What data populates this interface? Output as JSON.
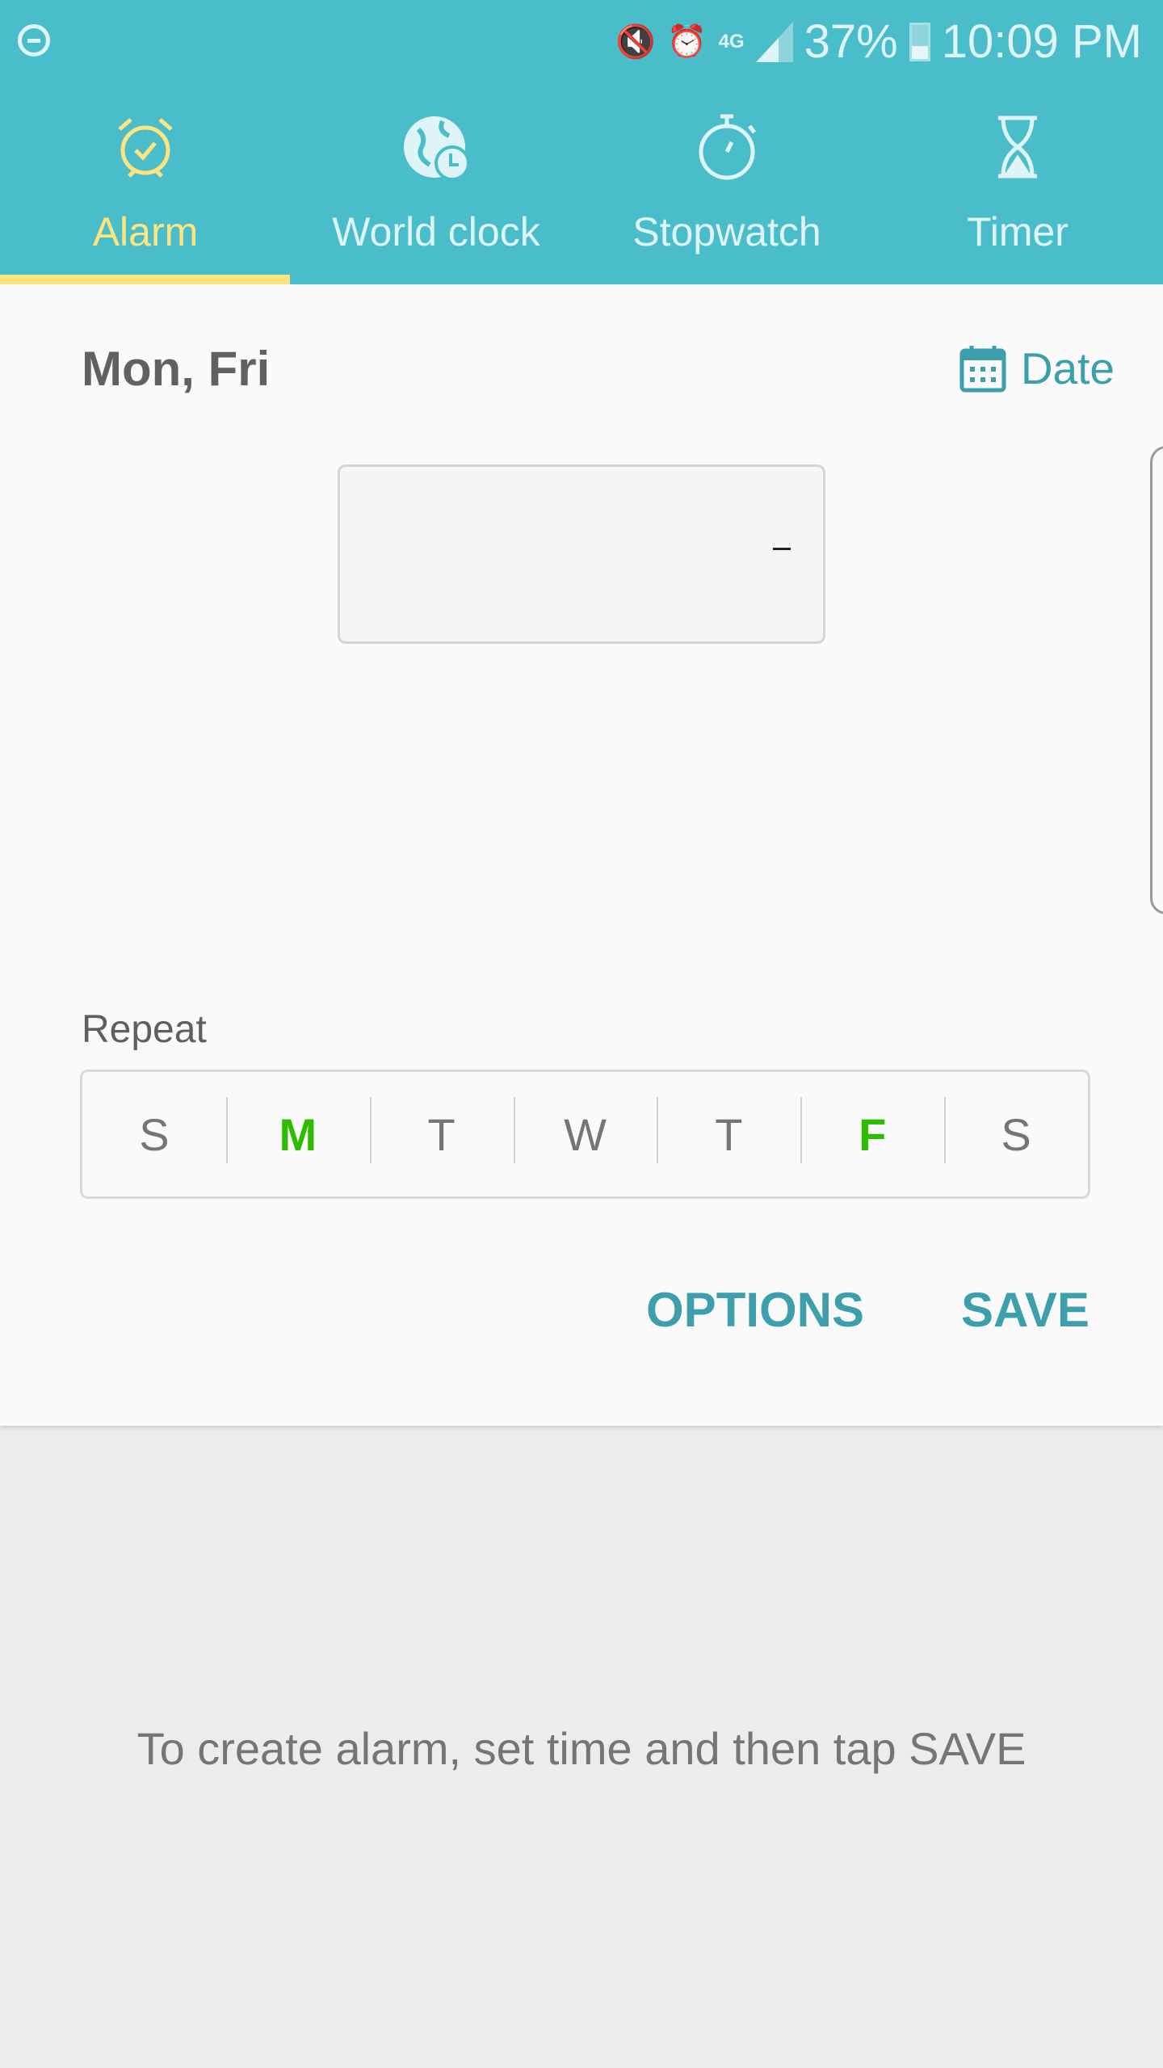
{
  "status_bar": {
    "battery": "37%",
    "time": "10:09 PM",
    "network": "4G",
    "icons": [
      "do-not-disturb-icon",
      "vibrate-mute-icon",
      "alarm-icon",
      "network-4g-icon",
      "signal-icon",
      "battery-icon"
    ]
  },
  "tabs": [
    {
      "label": "Alarm",
      "icon": "alarm-clock-icon",
      "active": true
    },
    {
      "label": "World clock",
      "icon": "globe-clock-icon"
    },
    {
      "label": "Stopwatch",
      "icon": "stopwatch-icon"
    },
    {
      "label": "Timer",
      "icon": "hourglass-icon"
    }
  ],
  "editor": {
    "days_summary": "Mon, Fri",
    "date_label": "Date",
    "repeat_label": "Repeat",
    "days": [
      {
        "label": "S",
        "on": false
      },
      {
        "label": "M",
        "on": true
      },
      {
        "label": "T",
        "on": false
      },
      {
        "label": "W",
        "on": false
      },
      {
        "label": "T",
        "on": false
      },
      {
        "label": "F",
        "on": true
      },
      {
        "label": "S",
        "on": false
      }
    ],
    "options_label": "OPTIONS",
    "save_label": "SAVE"
  },
  "hint": "To create alarm, set time and then tap SAVE",
  "colors": {
    "header": "#4abdcb",
    "active_tab": "#fde47f",
    "accent": "#3d9fab",
    "selected_day": "#2dbd00"
  }
}
